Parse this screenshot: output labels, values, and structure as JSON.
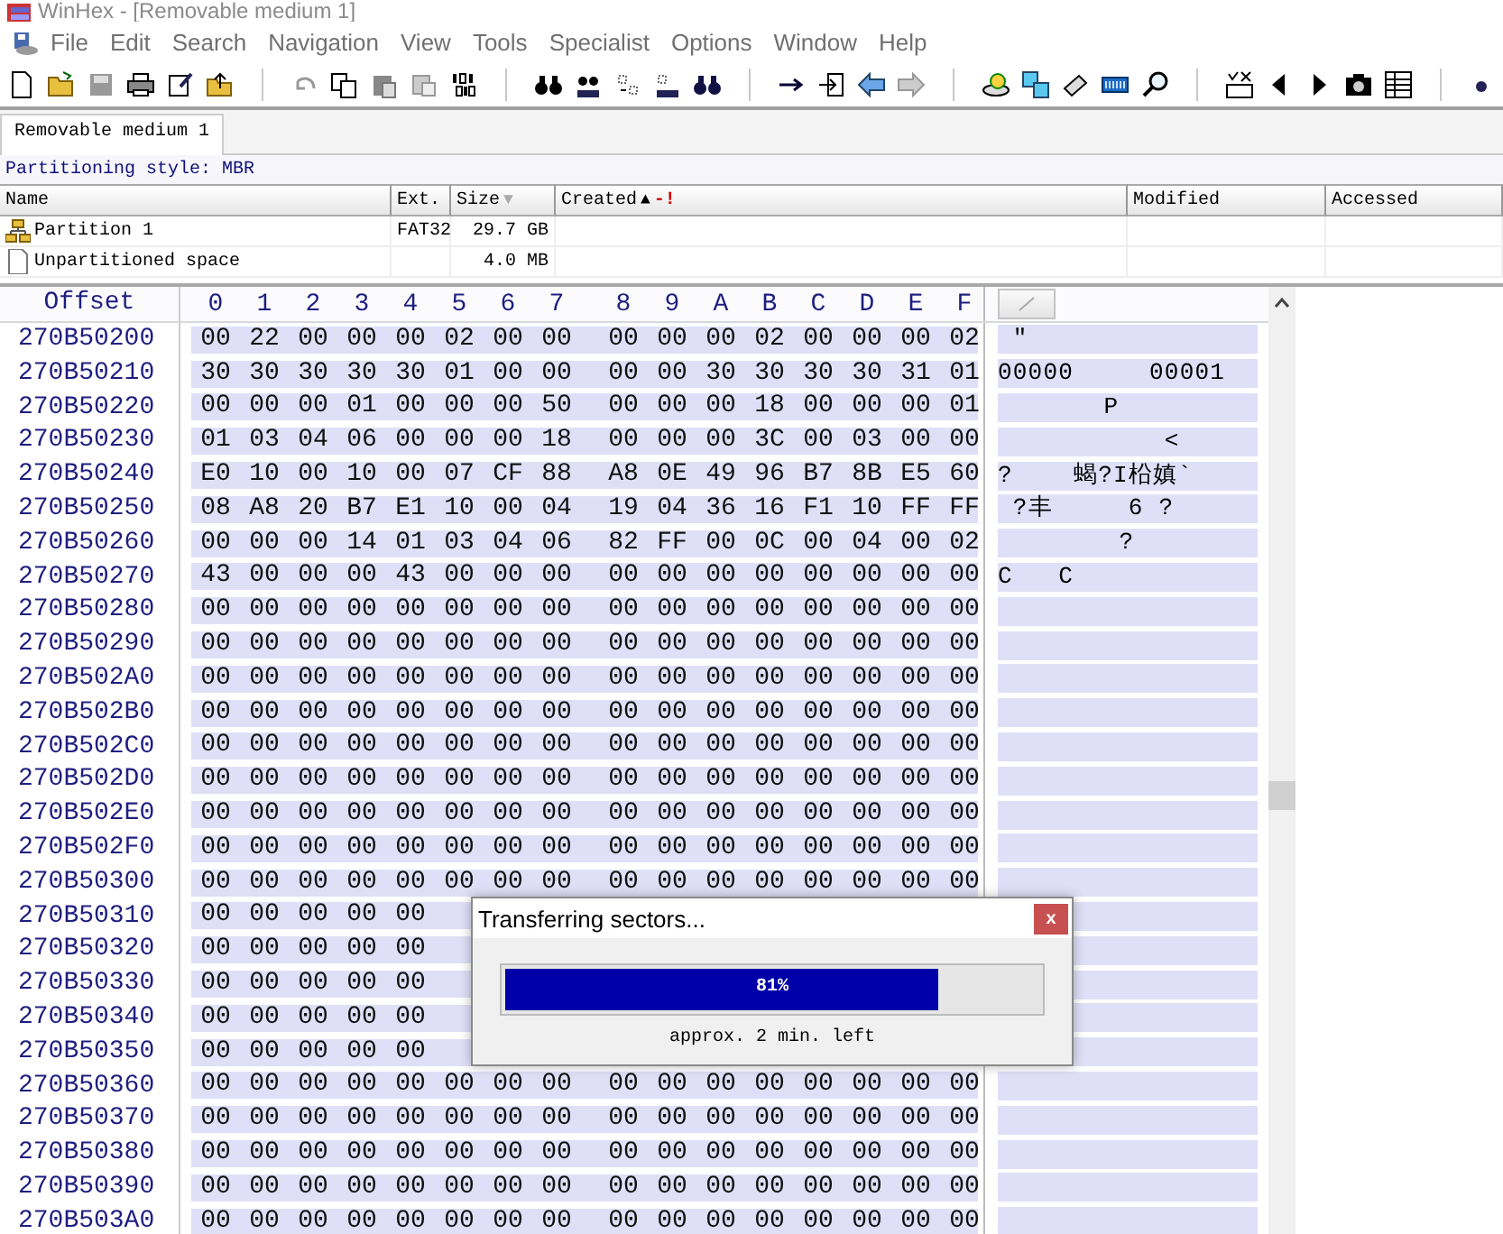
{
  "window": {
    "title": "WinHex - [Removable medium 1]"
  },
  "menu": [
    {
      "label": "File"
    },
    {
      "label": "Edit"
    },
    {
      "label": "Search"
    },
    {
      "label": "Navigation"
    },
    {
      "label": "View"
    },
    {
      "label": "Tools"
    },
    {
      "label": "Specialist"
    },
    {
      "label": "Options"
    },
    {
      "label": "Window"
    },
    {
      "label": "Help"
    }
  ],
  "tabs": [
    {
      "label": "Removable medium 1",
      "selected": true
    }
  ],
  "partitioning_style": "Partitioning style: MBR",
  "partition_table": {
    "columns": [
      {
        "label": "Name"
      },
      {
        "label": "Ext."
      },
      {
        "label": "Size",
        "sort": "▼",
        "primary": false
      },
      {
        "label": "Created",
        "sort": "▲",
        "primary": true,
        "marker": "-!"
      },
      {
        "label": "Modified"
      },
      {
        "label": "Accessed"
      }
    ],
    "rows": [
      {
        "kind": "partition",
        "name": "Partition 1",
        "ext": "FAT32",
        "size": "29.7 GB"
      },
      {
        "kind": "free",
        "name": "Unpartitioned space",
        "size": "4.0 MB"
      }
    ]
  },
  "hex": {
    "offset_label": "Offset",
    "columns": [
      "0",
      "1",
      "2",
      "3",
      "4",
      "5",
      "6",
      "7",
      "8",
      "9",
      "A",
      "B",
      "C",
      "D",
      "E",
      "F"
    ],
    "rows": [
      {
        "offset": "270B50200",
        "bytes": [
          "00",
          "22",
          "00",
          "00",
          "00",
          "02",
          "00",
          "00",
          "00",
          "00",
          "00",
          "02",
          "00",
          "00",
          "00",
          "02"
        ],
        "text": " \""
      },
      {
        "offset": "270B50210",
        "bytes": [
          "30",
          "30",
          "30",
          "30",
          "30",
          "01",
          "00",
          "00",
          "00",
          "00",
          "30",
          "30",
          "30",
          "30",
          "31",
          "01"
        ],
        "text": "00000     00001"
      },
      {
        "offset": "270B50220",
        "bytes": [
          "00",
          "00",
          "00",
          "01",
          "00",
          "00",
          "00",
          "50",
          "00",
          "00",
          "00",
          "18",
          "00",
          "00",
          "00",
          "01"
        ],
        "text": "       P"
      },
      {
        "offset": "270B50230",
        "bytes": [
          "01",
          "03",
          "04",
          "06",
          "00",
          "00",
          "00",
          "18",
          "00",
          "00",
          "00",
          "3C",
          "00",
          "03",
          "00",
          "00"
        ],
        "text": "           <"
      },
      {
        "offset": "270B50240",
        "bytes": [
          "E0",
          "10",
          "00",
          "10",
          "00",
          "07",
          "CF",
          "88",
          "A8",
          "0E",
          "49",
          "96",
          "B7",
          "8B",
          "E5",
          "60"
        ],
        "text": "?    蝎?I柗嫃`"
      },
      {
        "offset": "270B50250",
        "bytes": [
          "08",
          "A8",
          "20",
          "B7",
          "E1",
          "10",
          "00",
          "04",
          "19",
          "04",
          "36",
          "16",
          "F1",
          "10",
          "FF",
          "FF"
        ],
        "text": " ?丰     6 ?"
      },
      {
        "offset": "270B50260",
        "bytes": [
          "00",
          "00",
          "00",
          "14",
          "01",
          "03",
          "04",
          "06",
          "82",
          "FF",
          "00",
          "0C",
          "00",
          "04",
          "00",
          "02"
        ],
        "text": "        ?"
      },
      {
        "offset": "270B50270",
        "bytes": [
          "43",
          "00",
          "00",
          "00",
          "43",
          "00",
          "00",
          "00",
          "00",
          "00",
          "00",
          "00",
          "00",
          "00",
          "00",
          "00"
        ],
        "text": "C   C"
      },
      {
        "offset": "270B50280",
        "bytes": [
          "00",
          "00",
          "00",
          "00",
          "00",
          "00",
          "00",
          "00",
          "00",
          "00",
          "00",
          "00",
          "00",
          "00",
          "00",
          "00"
        ]
      },
      {
        "offset": "270B50290",
        "bytes": [
          "00",
          "00",
          "00",
          "00",
          "00",
          "00",
          "00",
          "00",
          "00",
          "00",
          "00",
          "00",
          "00",
          "00",
          "00",
          "00"
        ]
      },
      {
        "offset": "270B502A0",
        "bytes": [
          "00",
          "00",
          "00",
          "00",
          "00",
          "00",
          "00",
          "00",
          "00",
          "00",
          "00",
          "00",
          "00",
          "00",
          "00",
          "00"
        ]
      },
      {
        "offset": "270B502B0",
        "bytes": [
          "00",
          "00",
          "00",
          "00",
          "00",
          "00",
          "00",
          "00",
          "00",
          "00",
          "00",
          "00",
          "00",
          "00",
          "00",
          "00"
        ]
      },
      {
        "offset": "270B502C0",
        "bytes": [
          "00",
          "00",
          "00",
          "00",
          "00",
          "00",
          "00",
          "00",
          "00",
          "00",
          "00",
          "00",
          "00",
          "00",
          "00",
          "00"
        ]
      },
      {
        "offset": "270B502D0",
        "bytes": [
          "00",
          "00",
          "00",
          "00",
          "00",
          "00",
          "00",
          "00",
          "00",
          "00",
          "00",
          "00",
          "00",
          "00",
          "00",
          "00"
        ]
      },
      {
        "offset": "270B502E0",
        "bytes": [
          "00",
          "00",
          "00",
          "00",
          "00",
          "00",
          "00",
          "00",
          "00",
          "00",
          "00",
          "00",
          "00",
          "00",
          "00",
          "00"
        ]
      },
      {
        "offset": "270B502F0",
        "bytes": [
          "00",
          "00",
          "00",
          "00",
          "00",
          "00",
          "00",
          "00",
          "00",
          "00",
          "00",
          "00",
          "00",
          "00",
          "00",
          "00"
        ]
      },
      {
        "offset": "270B50300",
        "bytes": [
          "00",
          "00",
          "00",
          "00",
          "00",
          "00",
          "00",
          "00",
          "00",
          "00",
          "00",
          "00",
          "00",
          "00",
          "00",
          "00"
        ]
      },
      {
        "offset": "270B50310",
        "bytes": [
          "00",
          "00",
          "00",
          "00",
          "00"
        ]
      },
      {
        "offset": "270B50320",
        "bytes": [
          "00",
          "00",
          "00",
          "00",
          "00"
        ]
      },
      {
        "offset": "270B50330",
        "bytes": [
          "00",
          "00",
          "00",
          "00",
          "00"
        ]
      },
      {
        "offset": "270B50340",
        "bytes": [
          "00",
          "00",
          "00",
          "00",
          "00"
        ]
      },
      {
        "offset": "270B50350",
        "bytes": [
          "00",
          "00",
          "00",
          "00",
          "00"
        ]
      },
      {
        "offset": "270B50360",
        "bytes": [
          "00",
          "00",
          "00",
          "00",
          "00",
          "00",
          "00",
          "00",
          "00",
          "00",
          "00",
          "00",
          "00",
          "00",
          "00",
          "00"
        ]
      },
      {
        "offset": "270B50370",
        "bytes": [
          "00",
          "00",
          "00",
          "00",
          "00",
          "00",
          "00",
          "00",
          "00",
          "00",
          "00",
          "00",
          "00",
          "00",
          "00",
          "00"
        ]
      },
      {
        "offset": "270B50380",
        "bytes": [
          "00",
          "00",
          "00",
          "00",
          "00",
          "00",
          "00",
          "00",
          "00",
          "00",
          "00",
          "00",
          "00",
          "00",
          "00",
          "00"
        ]
      },
      {
        "offset": "270B50390",
        "bytes": [
          "00",
          "00",
          "00",
          "00",
          "00",
          "00",
          "00",
          "00",
          "00",
          "00",
          "00",
          "00",
          "00",
          "00",
          "00",
          "00"
        ]
      },
      {
        "offset": "270B503A0",
        "bytes": [
          "00",
          "00",
          "00",
          "00",
          "00",
          "00",
          "00",
          "00",
          "00",
          "00",
          "00",
          "00",
          "00",
          "00",
          "00",
          "00"
        ]
      }
    ]
  },
  "dialog": {
    "title": "Transferring sectors...",
    "close": "x",
    "level": 0.81,
    "percent": "81%",
    "remaining": "approx. 2 min. left"
  }
}
